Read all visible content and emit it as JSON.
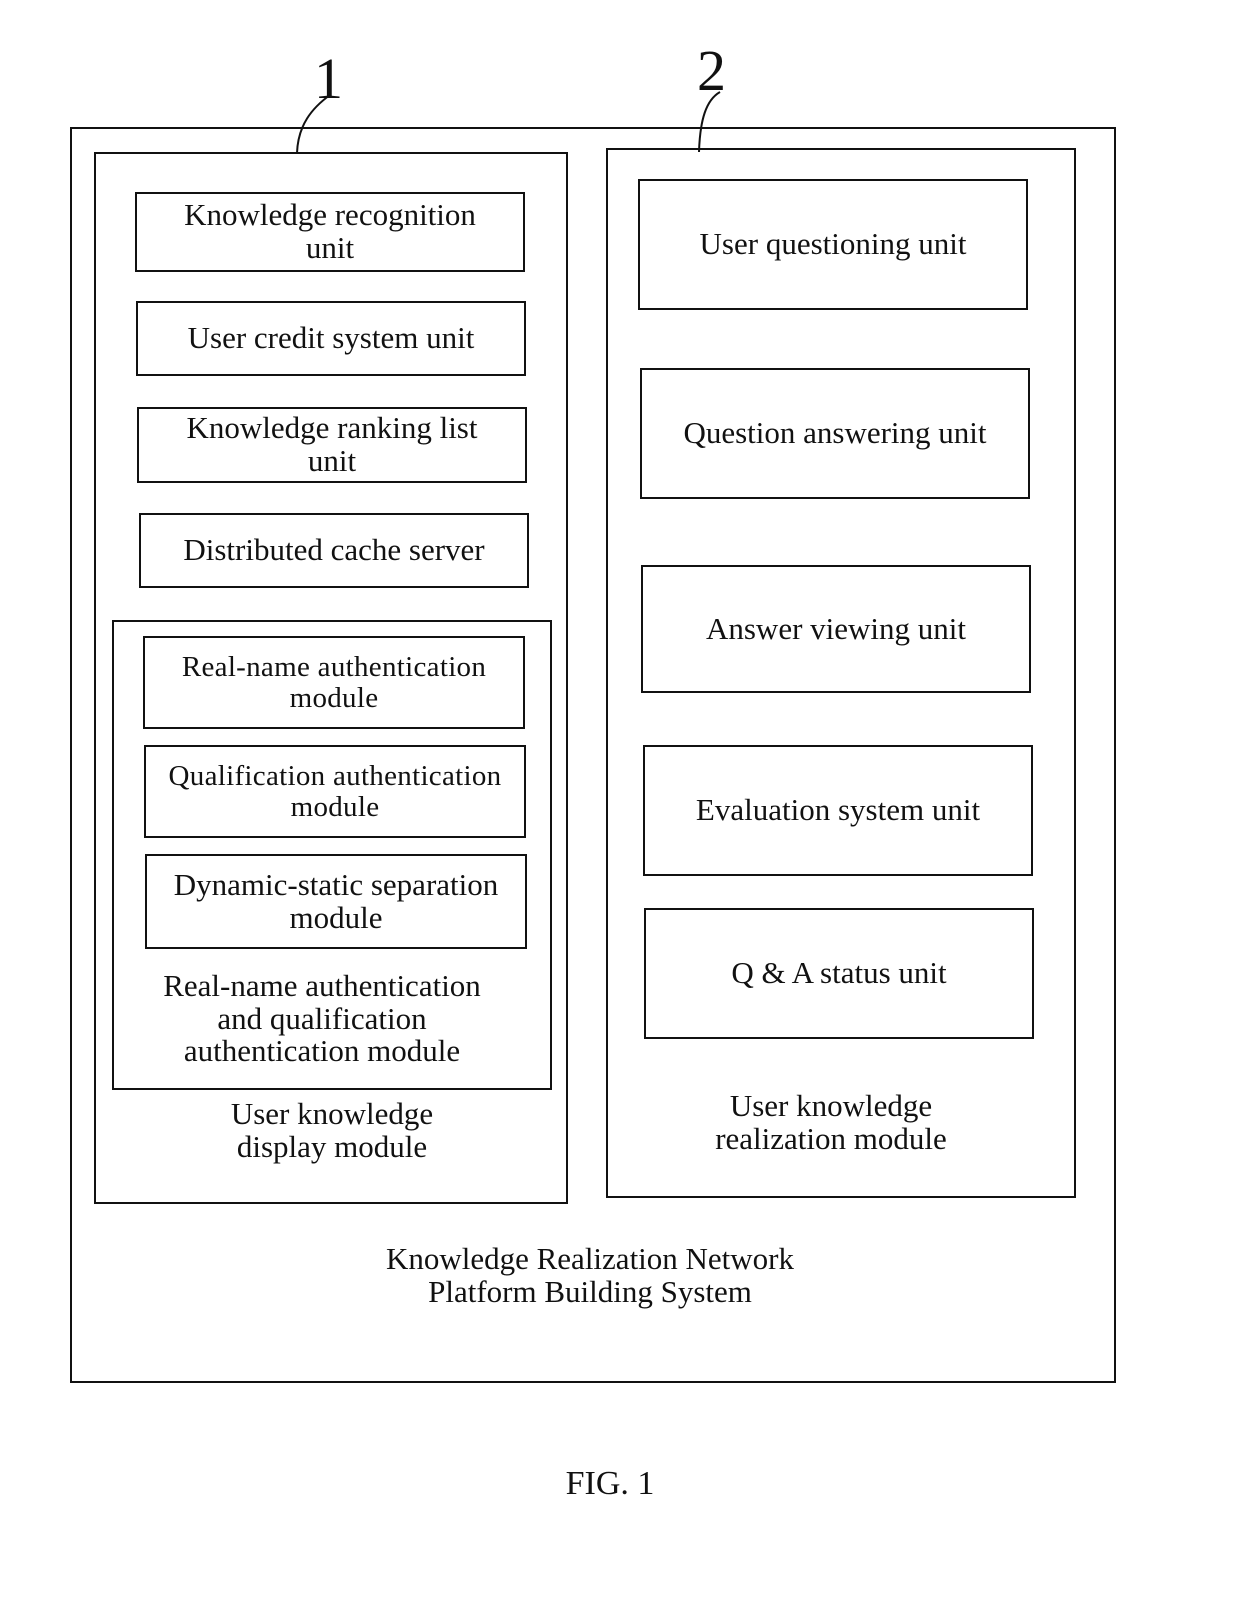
{
  "figure_caption": "FIG. 1",
  "system": {
    "label": "Knowledge Realization Network Platform Building System",
    "label_lines": [
      "Knowledge Realization Network",
      "Platform Building System"
    ]
  },
  "reference_numerals": [
    "1",
    "2"
  ],
  "left_module": {
    "numeral": "1",
    "label_lines": [
      "User knowledge",
      "display module"
    ],
    "units": [
      {
        "lines": [
          "Knowledge recognition",
          "unit"
        ]
      },
      {
        "lines": [
          "User credit system unit"
        ]
      },
      {
        "lines": [
          "Knowledge ranking list",
          "unit"
        ]
      },
      {
        "lines": [
          "Distributed cache server"
        ]
      }
    ],
    "auth_group": {
      "label_lines": [
        "Real-name authentication",
        "and qualification",
        "authentication module"
      ],
      "modules": [
        {
          "lines": [
            "Real-name authentication",
            "module"
          ]
        },
        {
          "lines": [
            "Qualification authentication",
            "module"
          ]
        },
        {
          "lines": [
            "Dynamic-static separation",
            "module"
          ]
        }
      ]
    }
  },
  "right_module": {
    "numeral": "2",
    "label_lines": [
      "User knowledge",
      "realization module"
    ],
    "units": [
      {
        "lines": [
          "User questioning unit"
        ]
      },
      {
        "lines": [
          "Question answering unit"
        ]
      },
      {
        "lines": [
          "Answer viewing unit"
        ]
      },
      {
        "lines": [
          "Evaluation system unit"
        ]
      },
      {
        "lines": [
          "Q & A status unit"
        ]
      }
    ]
  }
}
